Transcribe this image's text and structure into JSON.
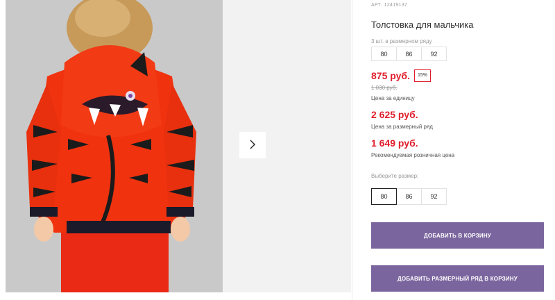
{
  "gallery": {
    "next_icon": "chevron-right-icon"
  },
  "product": {
    "sku_label": "АРТ.",
    "sku_value": "12419137",
    "title": "Толстовка для мальчика",
    "pack_note": "3 шт. в размерном ряду",
    "pack_sizes": [
      "80",
      "86",
      "92"
    ],
    "price": "875 руб.",
    "discount": "15%",
    "old_price": "1 030 руб.",
    "unit_caption": "Цена за единицу",
    "row_price": "2 625 руб.",
    "row_caption": "Цена за размерный ряд",
    "retail_price": "1 649 руб.",
    "retail_caption": "Рекомендуемая розничная цена",
    "choose_size_label": "Выберите размер:",
    "size_options": [
      "80",
      "86",
      "92"
    ],
    "selected_size": "80",
    "add_to_cart": "ДОБАВИТЬ В КОРЗИНУ",
    "add_row_to_cart": "ДОБАВИТЬ РАЗМЕРНЫЙ РЯД В КОРЗИНУ"
  },
  "colors": {
    "price_red": "#e01e2b",
    "button_purple": "#7b659e"
  }
}
